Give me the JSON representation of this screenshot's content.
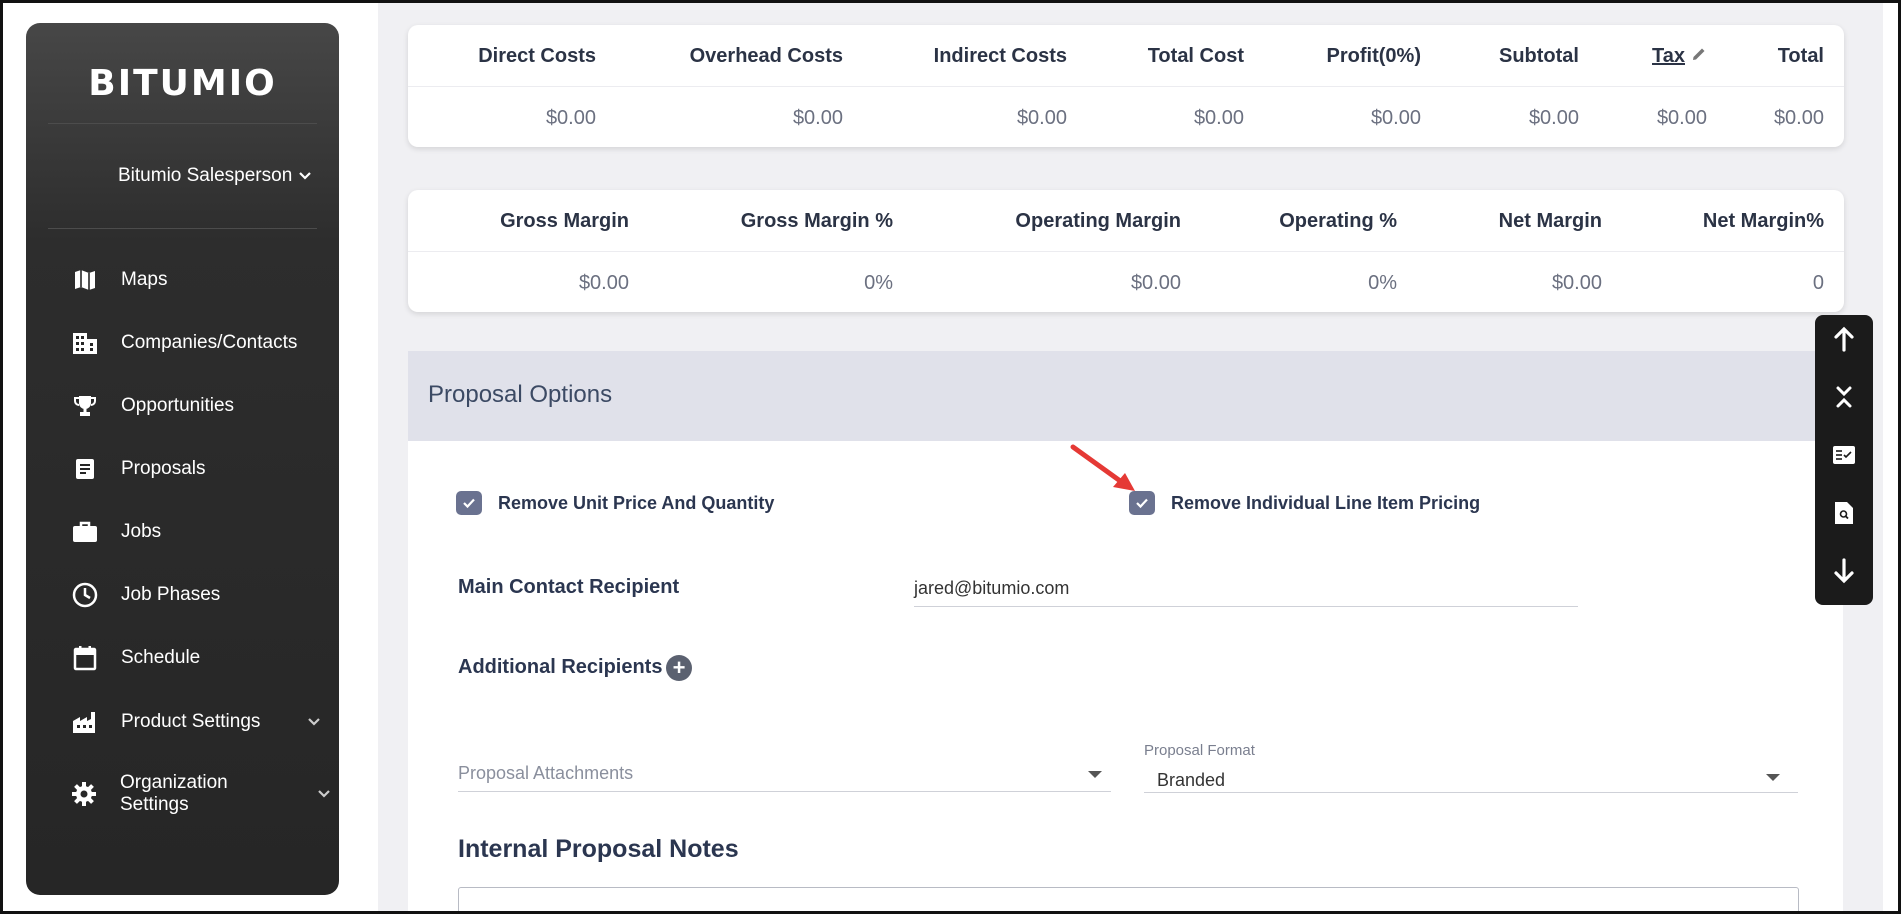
{
  "sidebar": {
    "logo": "BITUMIO",
    "user": "Bitumio Salesperson",
    "items": [
      {
        "label": "Maps",
        "icon": "map-icon"
      },
      {
        "label": "Companies/Contacts",
        "icon": "building-icon"
      },
      {
        "label": "Opportunities",
        "icon": "trophy-icon"
      },
      {
        "label": "Proposals",
        "icon": "document-icon"
      },
      {
        "label": "Jobs",
        "icon": "briefcase-icon"
      },
      {
        "label": "Job Phases",
        "icon": "clock-icon"
      },
      {
        "label": "Schedule",
        "icon": "calendar-icon"
      },
      {
        "label": "Product Settings",
        "icon": "factory-icon"
      },
      {
        "label": "Organization Settings",
        "icon": "gear-icon"
      }
    ]
  },
  "costs": {
    "headers": [
      "Direct Costs",
      "Overhead Costs",
      "Indirect Costs",
      "Total Cost",
      "Profit(0%)",
      "Subtotal",
      "Tax",
      "Total"
    ],
    "values": [
      "$0.00",
      "$0.00",
      "$0.00",
      "$0.00",
      "$0.00",
      "$0.00",
      "$0.00",
      "$0.00"
    ]
  },
  "margins": {
    "headers": [
      "Gross Margin",
      "Gross Margin %",
      "Operating Margin",
      "Operating %",
      "Net Margin",
      "Net Margin%"
    ],
    "values": [
      "$0.00",
      "0%",
      "$0.00",
      "0%",
      "$0.00",
      "0"
    ]
  },
  "proposal_options": {
    "title": "Proposal Options",
    "remove_unit_price": {
      "label": "Remove Unit Price And Quantity",
      "checked": true
    },
    "remove_line_item_pricing": {
      "label": "Remove Individual Line Item Pricing",
      "checked": true
    },
    "main_contact_label": "Main Contact Recipient",
    "main_contact_value": "jared@bitumio.com",
    "additional_recipients_label": "Additional Recipients",
    "attachments_placeholder": "Proposal Attachments",
    "format_label": "Proposal Format",
    "format_value": "Branded",
    "notes_title": "Internal Proposal Notes"
  },
  "colors": {
    "checkbox": "#6a7290",
    "annotation_arrow": "#e53935",
    "header_band": "#e0e1ea"
  }
}
